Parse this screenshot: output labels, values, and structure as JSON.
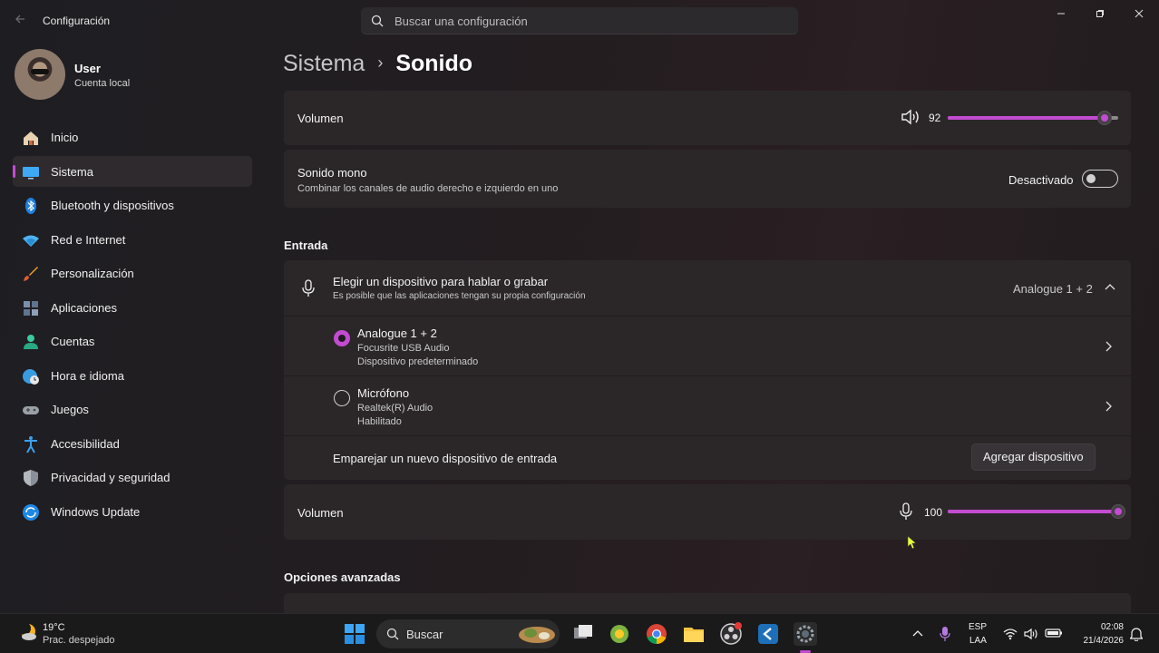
{
  "window": {
    "app_title": "Configuración",
    "search_placeholder": "Buscar una configuración"
  },
  "profile": {
    "name": "User",
    "account": "Cuenta local"
  },
  "nav": {
    "items": [
      {
        "label": "Inicio",
        "icon": "home-icon"
      },
      {
        "label": "Sistema",
        "icon": "monitor-icon",
        "selected": true
      },
      {
        "label": "Bluetooth y dispositivos",
        "icon": "bluetooth-icon"
      },
      {
        "label": "Red e Internet",
        "icon": "wifi-icon"
      },
      {
        "label": "Personalización",
        "icon": "brush-icon"
      },
      {
        "label": "Aplicaciones",
        "icon": "apps-icon"
      },
      {
        "label": "Cuentas",
        "icon": "person-icon"
      },
      {
        "label": "Hora e idioma",
        "icon": "globe-clock-icon"
      },
      {
        "label": "Juegos",
        "icon": "gamepad-icon"
      },
      {
        "label": "Accesibilidad",
        "icon": "accessibility-icon"
      },
      {
        "label": "Privacidad y seguridad",
        "icon": "shield-icon"
      },
      {
        "label": "Windows Update",
        "icon": "update-icon"
      }
    ]
  },
  "breadcrumb": {
    "parent": "Sistema",
    "separator": "›",
    "current": "Sonido"
  },
  "output": {
    "volume_label": "Volumen",
    "volume_value": "92",
    "volume_level": 92,
    "mono_title": "Sonido mono",
    "mono_desc": "Combinar los canales de audio derecho e izquierdo en uno",
    "mono_state": "Desactivado"
  },
  "input": {
    "section_title": "Entrada",
    "chooser_title": "Elegir un dispositivo para hablar o grabar",
    "chooser_desc": "Es posible que las aplicaciones tengan su propia configuración",
    "selected_device": "Analogue 1 + 2",
    "devices": [
      {
        "name": "Analogue 1 + 2",
        "driver": "Focusrite USB Audio",
        "status": "Dispositivo predeterminado",
        "selected": true
      },
      {
        "name": "Micrófono",
        "driver": "Realtek(R) Audio",
        "status": "Habilitado",
        "selected": false
      }
    ],
    "pair_label": "Emparejar un nuevo dispositivo de entrada",
    "add_button": "Agregar dispositivo",
    "volume_label": "Volumen",
    "volume_value": "100",
    "volume_level": 100
  },
  "advanced": {
    "section_title": "Opciones avanzadas"
  },
  "taskbar": {
    "weather_temp": "19°C",
    "weather_desc": "Prac. despejado",
    "search_label": "Buscar",
    "lang_top": "ESP",
    "lang_bottom": "LAA",
    "time": "02:08",
    "date": "21/4/2026"
  },
  "colors": {
    "accent": "#c34bd2",
    "card": "#2b2729",
    "background": "#1f1c1f"
  }
}
